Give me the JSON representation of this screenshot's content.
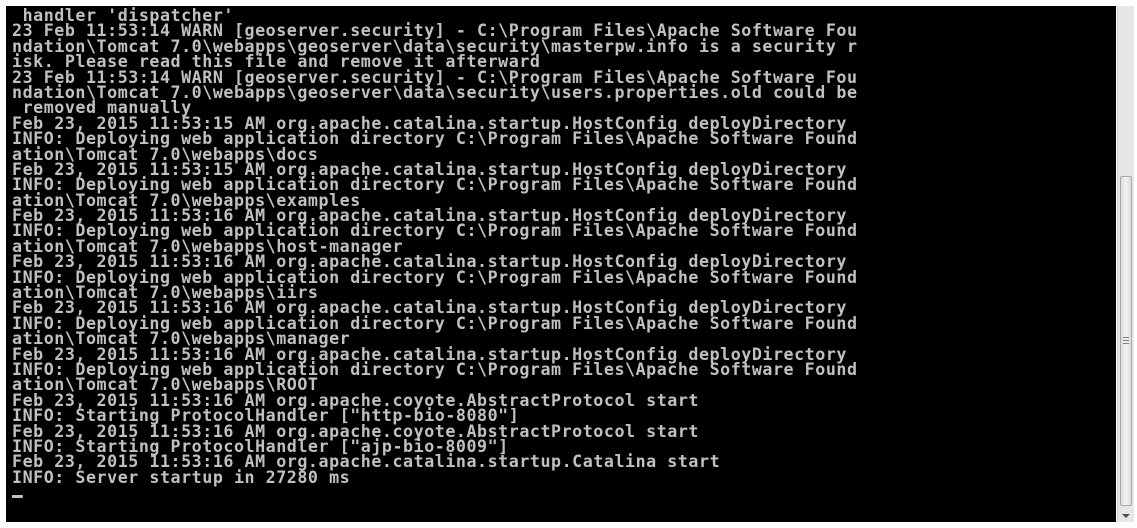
{
  "console": {
    "lines": [
      " handler 'dispatcher'",
      "23 Feb 11:53:14 WARN [geoserver.security] - C:\\Program Files\\Apache Software Fou",
      "ndation\\Tomcat 7.0\\webapps\\geoserver\\data\\security\\masterpw.info is a security r",
      "isk. Please read this file and remove it afterward",
      "23 Feb 11:53:14 WARN [geoserver.security] - C:\\Program Files\\Apache Software Fou",
      "ndation\\Tomcat 7.0\\webapps\\geoserver\\data\\security\\users.properties.old could be",
      " removed manually",
      "Feb 23, 2015 11:53:15 AM org.apache.catalina.startup.HostConfig deployDirectory",
      "INFO: Deploying web application directory C:\\Program Files\\Apache Software Found",
      "ation\\Tomcat 7.0\\webapps\\docs",
      "Feb 23, 2015 11:53:15 AM org.apache.catalina.startup.HostConfig deployDirectory",
      "INFO: Deploying web application directory C:\\Program Files\\Apache Software Found",
      "ation\\Tomcat 7.0\\webapps\\examples",
      "Feb 23, 2015 11:53:16 AM org.apache.catalina.startup.HostConfig deployDirectory",
      "INFO: Deploying web application directory C:\\Program Files\\Apache Software Found",
      "ation\\Tomcat 7.0\\webapps\\host-manager",
      "Feb 23, 2015 11:53:16 AM org.apache.catalina.startup.HostConfig deployDirectory",
      "INFO: Deploying web application directory C:\\Program Files\\Apache Software Found",
      "ation\\Tomcat 7.0\\webapps\\iirs",
      "Feb 23, 2015 11:53:16 AM org.apache.catalina.startup.HostConfig deployDirectory",
      "INFO: Deploying web application directory C:\\Program Files\\Apache Software Found",
      "ation\\Tomcat 7.0\\webapps\\manager",
      "Feb 23, 2015 11:53:16 AM org.apache.catalina.startup.HostConfig deployDirectory",
      "INFO: Deploying web application directory C:\\Program Files\\Apache Software Found",
      "ation\\Tomcat 7.0\\webapps\\ROOT",
      "Feb 23, 2015 11:53:16 AM org.apache.coyote.AbstractProtocol start",
      "INFO: Starting ProtocolHandler [\"http-bio-8080\"]",
      "Feb 23, 2015 11:53:16 AM org.apache.coyote.AbstractProtocol start",
      "INFO: Starting ProtocolHandler [\"ajp-bio-8009\"]",
      "Feb 23, 2015 11:53:16 AM org.apache.catalina.startup.Catalina start",
      "INFO: Server startup in 27280 ms"
    ]
  },
  "colors": {
    "background": "#000000",
    "text": "#c0c0c0",
    "scrollbar": "#e6e6e6"
  },
  "icons": {
    "scroll_down": "scroll-down-arrow-icon",
    "cursor": "text-cursor-icon"
  }
}
